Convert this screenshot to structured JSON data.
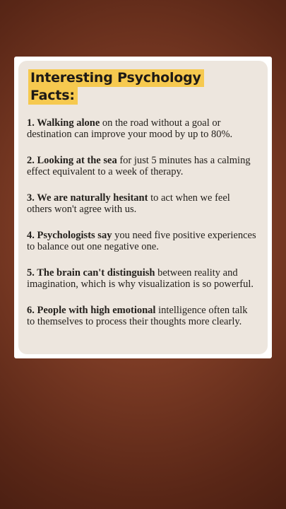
{
  "title": {
    "line1": "Interesting Psychology",
    "line2": "Facts:"
  },
  "facts": [
    {
      "lead": "1. Walking alone",
      "rest": " on the road without a goal or destination can improve your mood by up to 80%."
    },
    {
      "lead": "2. Looking at the sea",
      "rest": " for just 5 minutes has a calming effect equivalent to a week of therapy."
    },
    {
      "lead": "3. We are naturally hesitant",
      "rest": " to act when we feel others won't agree with us."
    },
    {
      "lead": "4. Psychologists say",
      "rest": " you need five positive experiences to balance out one negative one."
    },
    {
      "lead": "5. The brain can't distinguish",
      "rest": " between reality and imagination, which is why visualization is so powerful."
    },
    {
      "lead": "6. People with high emotional",
      "rest": " intelligence often talk to themselves to process their thoughts more clearly."
    }
  ],
  "colors": {
    "title_highlight": "#f6c94f",
    "card_background": "#ede6de",
    "page_background": "#7a3a24"
  }
}
